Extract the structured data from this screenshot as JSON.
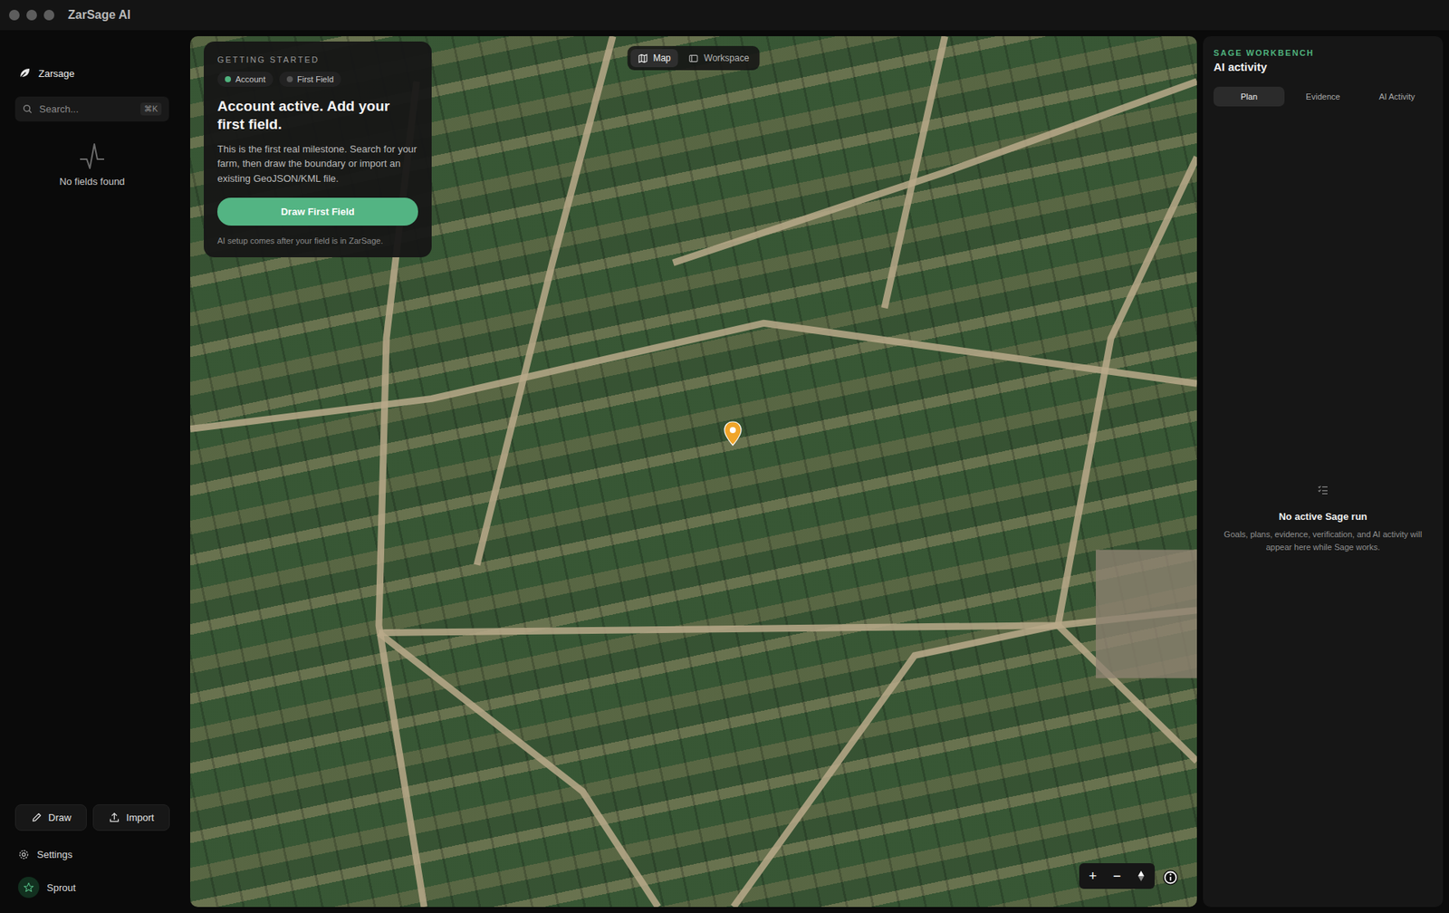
{
  "window": {
    "title": "ZarSage AI"
  },
  "sidebar": {
    "brand": "Zarsage",
    "search": {
      "placeholder": "Search...",
      "shortcut": "⌘K"
    },
    "empty": "No fields found",
    "actions": [
      "Draw",
      "Import"
    ],
    "settings": "Settings",
    "user": "Sprout"
  },
  "map": {
    "view_toggle": [
      {
        "label": "Map",
        "selected": true
      },
      {
        "label": "Workspace",
        "selected": false
      }
    ],
    "onboarding": {
      "eyebrow": "GETTING STARTED",
      "steps": [
        {
          "label": "Account",
          "done": true
        },
        {
          "label": "First Field",
          "done": false
        }
      ],
      "title": "Account active. Add your first field.",
      "body": "This is the first real milestone. Search for your farm, then draw the boundary or import an existing GeoJSON/KML file.",
      "button": "Draw First Field",
      "note": "AI setup comes after your field is in ZarSage."
    },
    "zoom_in": "+",
    "zoom_out": "−"
  },
  "workbench": {
    "eyebrow": "SAGE WORKBENCH",
    "title": "AI activity",
    "tabs": [
      {
        "label": "Plan",
        "selected": true
      },
      {
        "label": "Evidence",
        "selected": false
      },
      {
        "label": "AI Activity",
        "selected": false
      }
    ],
    "empty_title": "No active Sage run",
    "empty_body": "Goals, plans, evidence, verification, and AI activity will appear here while Sage works."
  }
}
